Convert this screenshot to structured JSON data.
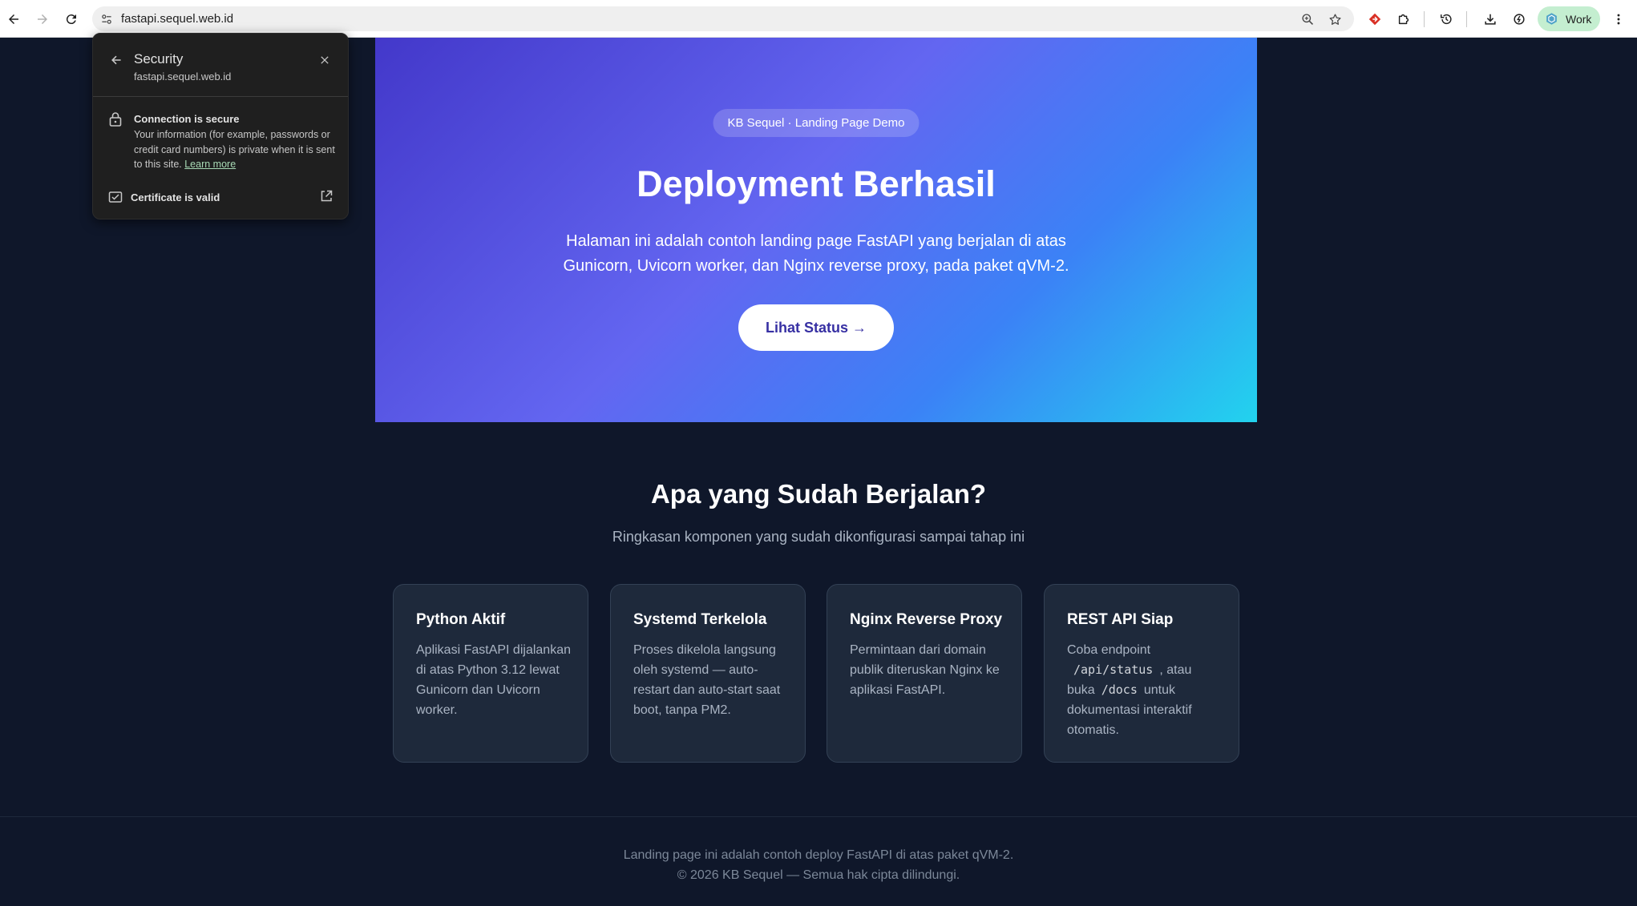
{
  "browser": {
    "url": "fastapi.sequel.web.id",
    "profile_label": "Work"
  },
  "security_popup": {
    "title": "Security",
    "host": "fastapi.sequel.web.id",
    "connection_title": "Connection is secure",
    "connection_info": "Your information (for example, passwords or credit card numbers) is private when it is sent to this site.",
    "learn_more": "Learn more",
    "certificate": "Certificate is valid"
  },
  "hero": {
    "badge": "KB Sequel · Landing Page Demo",
    "title": "Deployment Berhasil",
    "description": "Halaman ini adalah contoh landing page FastAPI yang berjalan di atas Gunicorn, Uvicorn worker, dan Nginx reverse proxy, pada paket qVM-2.",
    "button": "Lihat Status →"
  },
  "features": {
    "title": "Apa yang Sudah Berjalan?",
    "subtitle": "Ringkasan komponen yang sudah dikonfigurasi sampai tahap ini",
    "cards": [
      {
        "title": "Python Aktif",
        "desc": "Aplikasi FastAPI dijalankan di atas Python 3.12 lewat Gunicorn dan Uvicorn worker."
      },
      {
        "title": "Systemd Terkelola",
        "desc": "Proses dikelola langsung oleh systemd — auto-restart dan auto-start saat boot, tanpa PM2."
      },
      {
        "title": "Nginx Reverse Proxy",
        "desc": "Permintaan dari domain publik diteruskan Nginx ke aplikasi FastAPI."
      },
      {
        "title": "REST API Siap",
        "desc_pre": "Coba endpoint",
        "code1": "/api/status",
        "desc_mid1": ", atau buka",
        "code2": "/docs",
        "desc_mid2": "untuk dokumentasi interaktif otomatis."
      }
    ]
  },
  "footer": {
    "line1": "Landing page ini adalah contoh deploy FastAPI di atas paket qVM-2.",
    "line2": "© 2026 KB Sequel — Semua hak cipta dilindungi."
  },
  "colors": {
    "page_bg": "#0f172a",
    "card_bg": "#1e293b",
    "hero_start": "#4338ca",
    "hero_end": "#22d3ee",
    "button_text": "#3730a3"
  }
}
